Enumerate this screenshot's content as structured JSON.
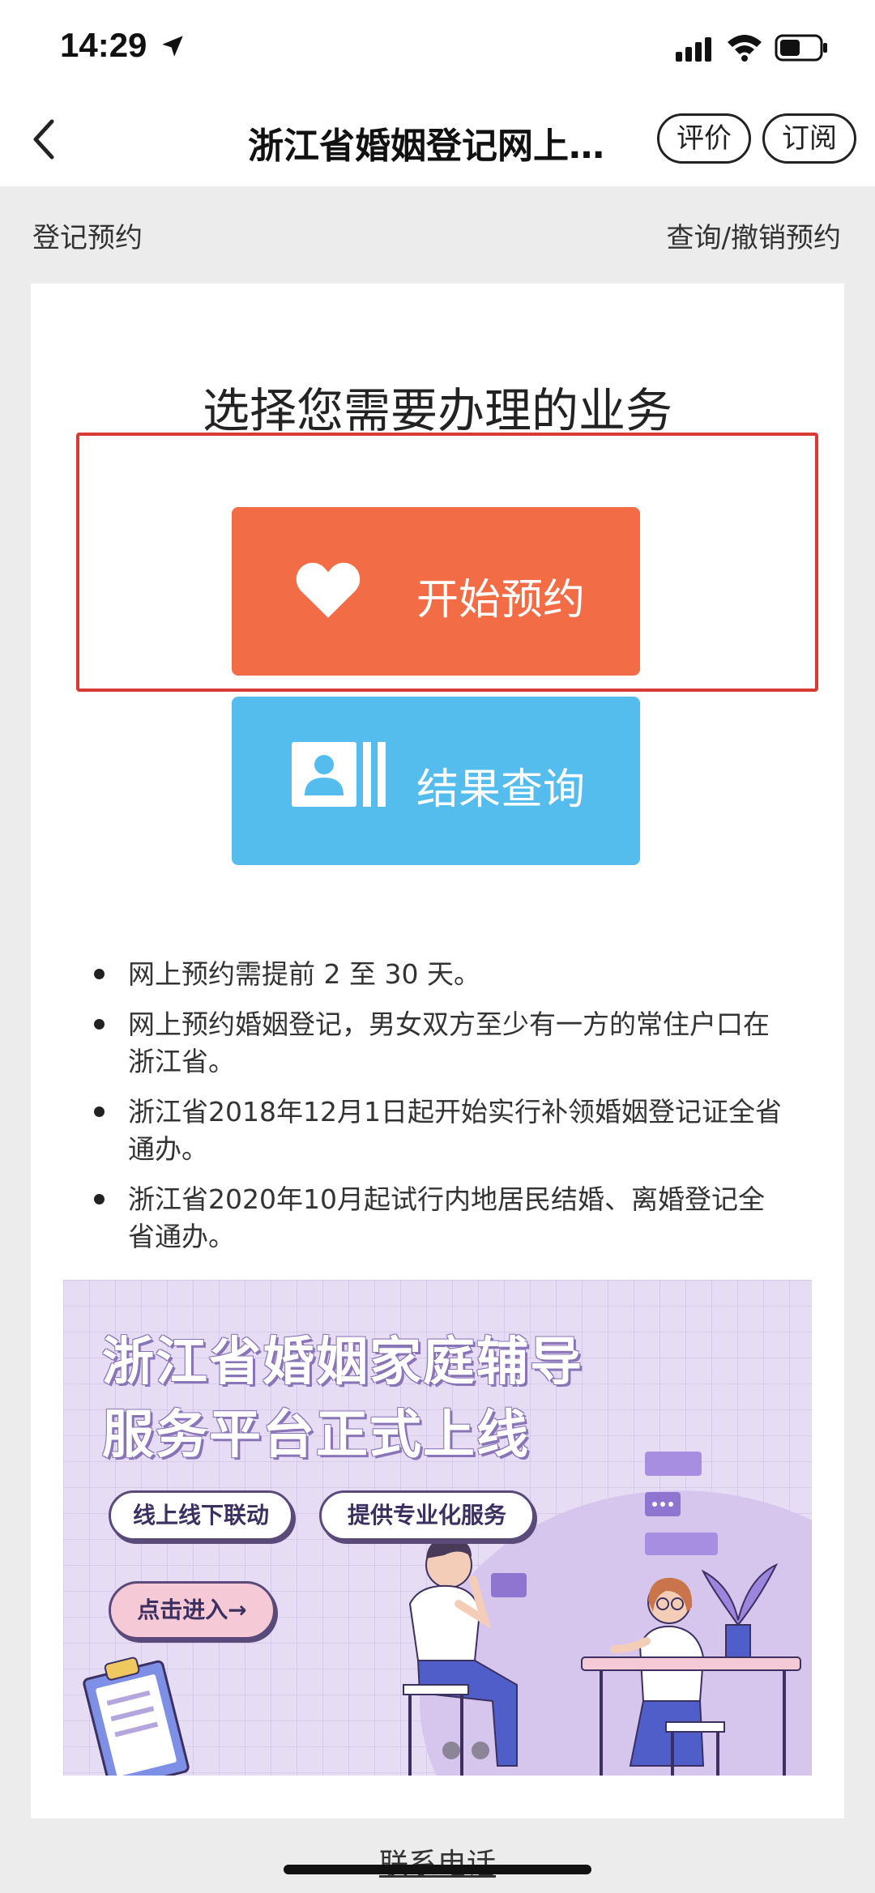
{
  "status_bar": {
    "time": "14:29"
  },
  "nav": {
    "title": "浙江省婚姻登记网上…",
    "rate_label": "评价",
    "subscribe_label": "订阅"
  },
  "subnav": {
    "left": "登记预约",
    "right": "查询/撤销预约"
  },
  "main": {
    "title": "选择您需要办理的业务",
    "start_label": "开始预约",
    "query_label": "结果查询"
  },
  "notes": [
    "网上预约需提前 2 至 30 天。",
    "网上预约婚姻登记，男女双方至少有一方的常住户口在浙江省。",
    "浙江省2018年12月1日起开始实行补领婚姻登记证全省通办。",
    "浙江省2020年10月起试行内地居民结婚、离婚登记全省通办。"
  ],
  "banner": {
    "title_line1": "浙江省婚姻家庭辅导",
    "title_line2": "服务平台正式上线",
    "tag1": "线上线下联动",
    "tag2": "提供专业化服务",
    "enter": "点击进入→"
  },
  "footer": {
    "contact": "联系电话"
  },
  "colors": {
    "start_button": "#f26c45",
    "query_button": "#55bdee",
    "highlight": "#d93a34"
  }
}
